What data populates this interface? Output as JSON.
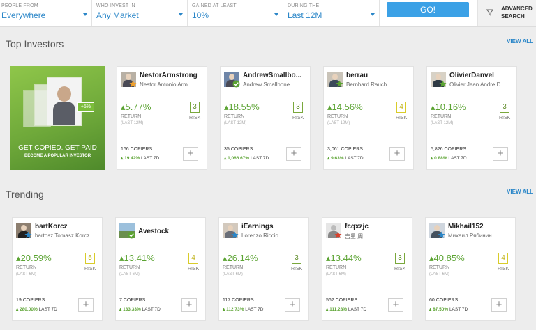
{
  "filters": [
    {
      "label": "PEOPLE FROM",
      "value": "Everywhere"
    },
    {
      "label": "WHO INVEST IN",
      "value": "Any Market"
    },
    {
      "label": "GAINED AT LEAST",
      "value": "10%"
    },
    {
      "label": "DURING THE",
      "value": "Last 12M"
    }
  ],
  "go_label": "GO!",
  "advanced_label": "ADVANCED SEARCH",
  "sections": [
    {
      "title": "Top Investors",
      "view_all": "VIEW ALL"
    },
    {
      "title": "Trending",
      "view_all": "VIEW ALL"
    }
  ],
  "promo": {
    "tagline": "GET COPIED. GET PAID",
    "sub": "BECOME A POPULAR INVESTOR",
    "badge": "+5%"
  },
  "labels": {
    "return": "RETURN",
    "risk": "RISK",
    "plus": "+",
    "period_12m": "(LAST 12M)",
    "period_6m": "(LAST 6M)"
  },
  "colors": {
    "accent": "#2a86c8",
    "gain": "#5ba332",
    "go_button": "#3ba1e6"
  },
  "top_investors": [
    {
      "username": "NestorArmstrong",
      "fullname": "Nestor Antonio Arm...",
      "return": "5.77%",
      "return_period": "(LAST 12M)",
      "risk": "3",
      "copiers": "166 COPIERS",
      "change": "19.42%",
      "change_suffix": "LAST 7D",
      "badge": "star-orange"
    },
    {
      "username": "AndrewSmallbo...",
      "fullname": "Andrew Smallbone",
      "return": "18.55%",
      "return_period": "(LAST 12M)",
      "risk": "3",
      "copiers": "35 COPIERS",
      "change": "1,066.67%",
      "change_suffix": "LAST 7D",
      "badge": "check-green"
    },
    {
      "username": "berrau",
      "fullname": "Bernhard Rauch",
      "return": "14.56%",
      "return_period": "(LAST 12M)",
      "risk": "4",
      "copiers": "3,061 COPIERS",
      "change": "9.63%",
      "change_suffix": "LAST 7D",
      "badge": "star-green"
    },
    {
      "username": "OlivierDanvel",
      "fullname": "Olivier Jean Andre D...",
      "return": "10.16%",
      "return_period": "(LAST 12M)",
      "risk": "3",
      "copiers": "5,826 COPIERS",
      "change": "0.88%",
      "change_suffix": "LAST 7D",
      "badge": "star-green"
    }
  ],
  "trending": [
    {
      "username": "bartKorcz",
      "fullname": "bartosz Tomasz Korcz",
      "return": "20.59%",
      "return_period": "(LAST 6M)",
      "risk": "5",
      "copiers": "19 COPIERS",
      "change": "280.00%",
      "change_suffix": "LAST 7D",
      "badge": "star-blue"
    },
    {
      "username": "Avestock",
      "fullname": "",
      "return": "13.41%",
      "return_period": "(LAST 6M)",
      "risk": "4",
      "copiers": "7 COPIERS",
      "change": "133.33%",
      "change_suffix": "LAST 7D",
      "badge": "check-green"
    },
    {
      "username": "iEarnings",
      "fullname": "Lorenzo Riccio",
      "return": "26.14%",
      "return_period": "(LAST 6M)",
      "risk": "3",
      "copiers": "117 COPIERS",
      "change": "112.73%",
      "change_suffix": "LAST 7D",
      "badge": "star-blue"
    },
    {
      "username": "fcqxzjc",
      "fullname": "吉星 周",
      "return": "13.44%",
      "return_period": "(LAST 6M)",
      "risk": "3",
      "copiers": "562 COPIERS",
      "change": "111.28%",
      "change_suffix": "LAST 7D",
      "badge": "star-red"
    },
    {
      "username": "Mikhail152",
      "fullname": "Михаил Рябинин",
      "return": "40.85%",
      "return_period": "(LAST 6M)",
      "risk": "4",
      "copiers": "60 COPIERS",
      "change": "87.50%",
      "change_suffix": "LAST 7D",
      "badge": "star-blue"
    }
  ]
}
